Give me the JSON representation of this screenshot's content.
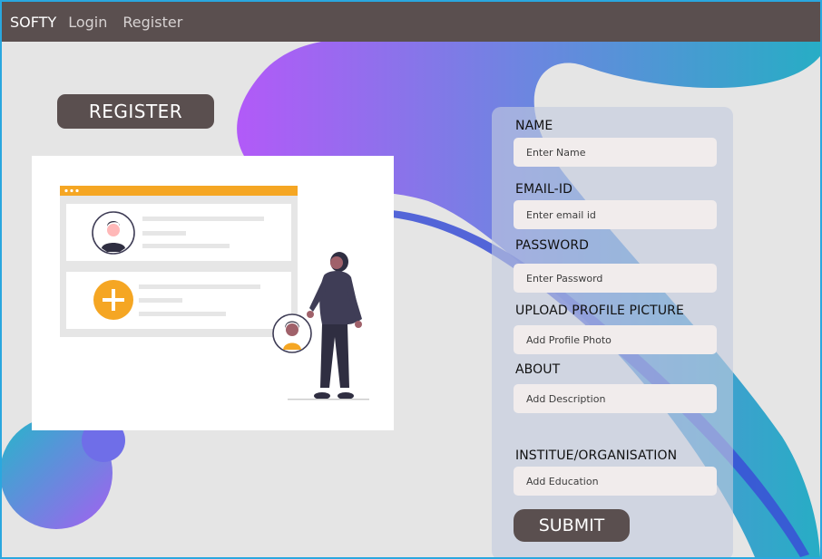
{
  "nav": {
    "brand": "SOFTY",
    "links": [
      "Login",
      "Register"
    ]
  },
  "hero": {
    "badge": "REGISTER"
  },
  "form": {
    "fields": [
      {
        "label": "NAME",
        "placeholder": "Enter Name"
      },
      {
        "label": "EMAIL-ID",
        "placeholder": "Enter email id"
      },
      {
        "label": "PASSWORD",
        "placeholder": "Enter Password"
      },
      {
        "label": "UPLOAD PROFILE PICTURE",
        "placeholder": "Add Profile Photo"
      },
      {
        "label": "ABOUT",
        "placeholder": "Add Description"
      },
      {
        "label": "INSTITUE/ORGANISATION",
        "placeholder": "Add Education"
      }
    ],
    "submit_label": "SUBMIT"
  },
  "colors": {
    "navbar": "#5a4f4f",
    "accent_orange": "#f5a623",
    "blob_purple": "#b45cf7",
    "blob_teal": "#2ab0c3"
  },
  "icons": [
    "plus-icon",
    "user-avatar-icon",
    "person-figure"
  ]
}
